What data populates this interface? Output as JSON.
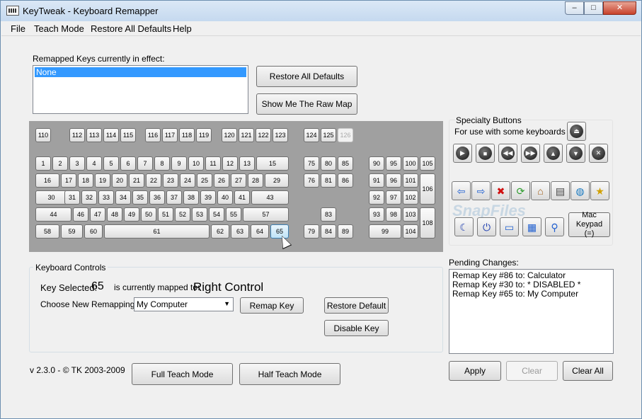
{
  "window": {
    "title": "KeyTweak -  Keyboard Remapper",
    "minimize_glyph": "–",
    "maximize_glyph": "□",
    "close_glyph": "✕"
  },
  "menu": {
    "items": [
      "File",
      "Teach Mode",
      "Restore All Defaults",
      "Help"
    ]
  },
  "remapped": {
    "label": "Remapped Keys currently in effect:",
    "items": [
      "None"
    ]
  },
  "buttons": {
    "restore_all_defaults": "Restore All Defaults",
    "show_raw_map": "Show Me The Raw Map",
    "remap_key": "Remap Key",
    "restore_default": "Restore Default",
    "disable_key": "Disable Key",
    "full_teach": "Full Teach Mode",
    "half_teach": "Half Teach Mode",
    "apply": "Apply",
    "clear": "Clear",
    "clear_all": "Clear All",
    "mac_keypad": "Mac Keypad (=)"
  },
  "keyboard": {
    "fkeys_left": [
      "110"
    ],
    "fkeys_1": [
      "112",
      "113",
      "114",
      "115"
    ],
    "fkeys_2": [
      "116",
      "117",
      "118",
      "119"
    ],
    "fkeys_3": [
      "120",
      "121",
      "122",
      "123"
    ],
    "fkeys_4": [
      "124",
      "125",
      "126"
    ],
    "row1": [
      "1",
      "2",
      "3",
      "4",
      "5",
      "6",
      "7",
      "8",
      "9",
      "10",
      "11",
      "12",
      "13",
      "15"
    ],
    "row2": [
      "16",
      "17",
      "18",
      "19",
      "20",
      "21",
      "22",
      "23",
      "24",
      "25",
      "26",
      "27",
      "28",
      "29"
    ],
    "row3": [
      "30",
      "31",
      "32",
      "33",
      "34",
      "35",
      "36",
      "37",
      "38",
      "39",
      "40",
      "41",
      "43"
    ],
    "row4": [
      "44",
      "46",
      "47",
      "48",
      "49",
      "50",
      "51",
      "52",
      "53",
      "54",
      "55",
      "57"
    ],
    "row5": [
      "58",
      "59",
      "60",
      "61",
      "62",
      "63",
      "64",
      "65"
    ],
    "nav1": [
      "75",
      "80",
      "85"
    ],
    "nav2": [
      "76",
      "81",
      "86"
    ],
    "arrows_up": [
      "83"
    ],
    "arrows": [
      "79",
      "84",
      "89"
    ],
    "num1": [
      "90",
      "95",
      "100",
      "105"
    ],
    "num2": [
      "91",
      "96",
      "101"
    ],
    "num3": [
      "92",
      "97",
      "102"
    ],
    "num4": [
      "93",
      "98",
      "103"
    ],
    "num5": [
      "99",
      "104"
    ],
    "num_tall": [
      "106",
      "108"
    ],
    "selected_key": "65",
    "disabled_key": "126"
  },
  "specialty": {
    "title": "Specialty Buttons",
    "subtitle": "For use with some keyboards",
    "icons_row1": [
      "eject-icon"
    ],
    "icons_row2": [
      "play-icon",
      "stop-icon",
      "prev-track-icon",
      "next-track-icon",
      "volume-up-icon",
      "volume-down-icon",
      "mute-icon"
    ],
    "icons_row3": [
      "back-icon",
      "forward-icon",
      "stop-browser-icon",
      "refresh-icon",
      "home-icon",
      "search-doc-icon",
      "web-globe-icon",
      "favorites-icon"
    ],
    "icons_row4": [
      "sleep-icon",
      "power-icon",
      "my-computer-icon",
      "calculator-icon",
      "search-icon"
    ],
    "watermark": "SnapFiles"
  },
  "pending": {
    "label": "Pending Changes:",
    "items": [
      "Remap Key #86 to: Calculator",
      "Remap Key #30 to: * DISABLED *",
      "Remap Key #65 to: My Computer"
    ]
  },
  "controls": {
    "title": "Keyboard Controls",
    "key_selected_label": "Key Selected:",
    "key_selected_value": "65",
    "mapped_label": "is currently mapped to:",
    "mapped_value": "Right Control",
    "choose_label": "Choose New Remapping",
    "choose_value": "My Computer"
  },
  "footer": {
    "version": "v 2.3.0 - © TK 2003-2009"
  },
  "colors": {
    "selection": "#3399ff",
    "keyboard_bg": "#a0a0a0"
  }
}
